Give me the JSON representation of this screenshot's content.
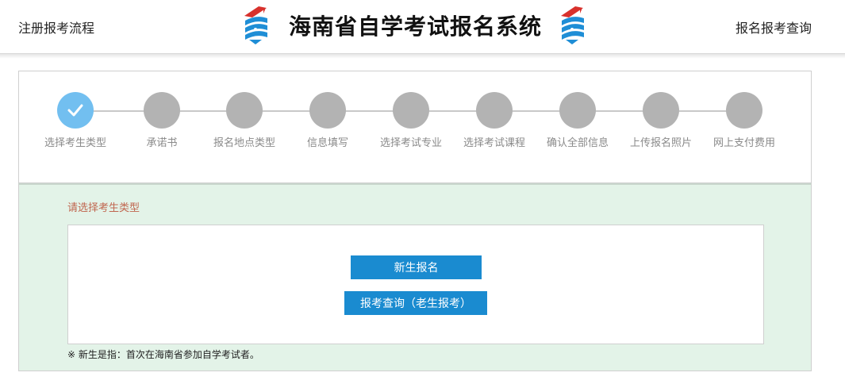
{
  "header": {
    "left_link": "注册报考流程",
    "title": "海南省自学考试报名系统",
    "right_link": "报名报考查询"
  },
  "steps": [
    {
      "label": "选择考生类型",
      "status": "done"
    },
    {
      "label": "承诺书",
      "status": "pending"
    },
    {
      "label": "报名地点类型",
      "status": "pending"
    },
    {
      "label": "信息填写",
      "status": "pending"
    },
    {
      "label": "选择考试专业",
      "status": "pending"
    },
    {
      "label": "选择考试课程",
      "status": "pending"
    },
    {
      "label": "确认全部信息",
      "status": "pending"
    },
    {
      "label": "上传报名照片",
      "status": "pending"
    },
    {
      "label": "网上支付费用",
      "status": "pending"
    }
  ],
  "main": {
    "prompt": "请选择考生类型",
    "new_button": "新生报名",
    "query_button": "报考查询（老生报考）",
    "note": "※ 新生是指：首次在海南省参加自学考试者。"
  },
  "colors": {
    "button": "#1a8bd0",
    "step_done": "#72bff0",
    "step_pending": "#b3b3b3",
    "content_bg": "#e3f3e8",
    "prompt_text": "#c0664f"
  }
}
